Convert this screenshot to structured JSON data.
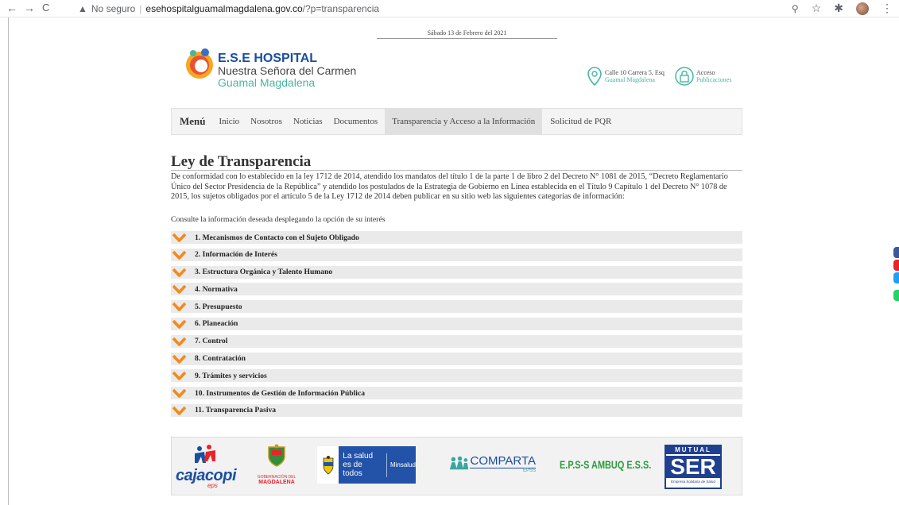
{
  "browser": {
    "insecure_label": "No seguro",
    "url_host": "esehospitalguamalmagdalena.gov.co",
    "url_path": "/?p=transparencia"
  },
  "header": {
    "date": "Sábado 13 de Febrero del 2021",
    "brand_line1": "E.S.E HOSPITAL",
    "brand_line2": "Nuestra Señora del Carmen",
    "brand_line3": "Guamal Magdalena",
    "address_line1": "Calle 10 Carrera 5, Esq",
    "address_line2": "Guamal Magdalena",
    "access_line1": "Acceso",
    "access_line2": "Publicaciones"
  },
  "menu": {
    "title": "Menú",
    "items": [
      {
        "label": "Inicio"
      },
      {
        "label": "Nosotros"
      },
      {
        "label": "Noticias"
      },
      {
        "label": "Documentos"
      },
      {
        "label": "Transparencia y Acceso a la Información"
      },
      {
        "label": "Solicitud de PQR"
      }
    ]
  },
  "content": {
    "title": "Ley de Transparencia",
    "intro": "De conformidad con lo establecido en la ley 1712 de 2014, atendido los mandatos del título 1 de la parte 1 de libro 2 del Decreto N° 1081 de 2015, “Decreto Reglamentario Único del Sector Presidencia de la República” y atendido los postulados de la Estrategia de Gobierno en Línea establecida en el Título 9 Capítulo 1 del Decreto N° 1078 de 2015, los sujetos obligados por el artículo 5 de la Ley 1712 de 2014 deben publicar en su sitio web las siguientes categorías de información:",
    "prompt": "Consulte la información deseada desplegando la opción de su interés",
    "sections": [
      {
        "label": "1. Mecanismos de Contacto con el Sujeto Obligado"
      },
      {
        "label": "2. Información de Interés"
      },
      {
        "label": "3. Estructura Orgánica y Talento Humano"
      },
      {
        "label": "4. Normativa"
      },
      {
        "label": "5. Presupuesto"
      },
      {
        "label": "6. Planeación"
      },
      {
        "label": "7. Control"
      },
      {
        "label": "8. Contratación"
      },
      {
        "label": "9. Trámites y servicios"
      },
      {
        "label": "10. Instrumentos de Gestión de Información Pública"
      },
      {
        "label": "11. Transparencia Pasiva"
      }
    ]
  },
  "footer_logos": {
    "cajacopi": "cajacopi",
    "cajacopi_sub": "eps",
    "gobernacion_line1": "GOBERNACIÓN DEL",
    "gobernacion_line2": "MAGDALENA",
    "minsalud_line1": "La salud",
    "minsalud_line2": "es de todos",
    "minsalud_brand": "Minsalud",
    "comparta": "COMPARTA",
    "comparta_sub": "EPSS",
    "ambuq": "E.P.S-S AMBUQ E.S.S.",
    "mutual_top": "MUTUAL",
    "mutual_main": "SER",
    "mutual_sub": "Empresa Solidaria de Salud"
  },
  "colors": {
    "accent_orange": "#f28a1e",
    "brand_blue": "#1a4ea0",
    "brand_teal": "#47b6a2"
  }
}
